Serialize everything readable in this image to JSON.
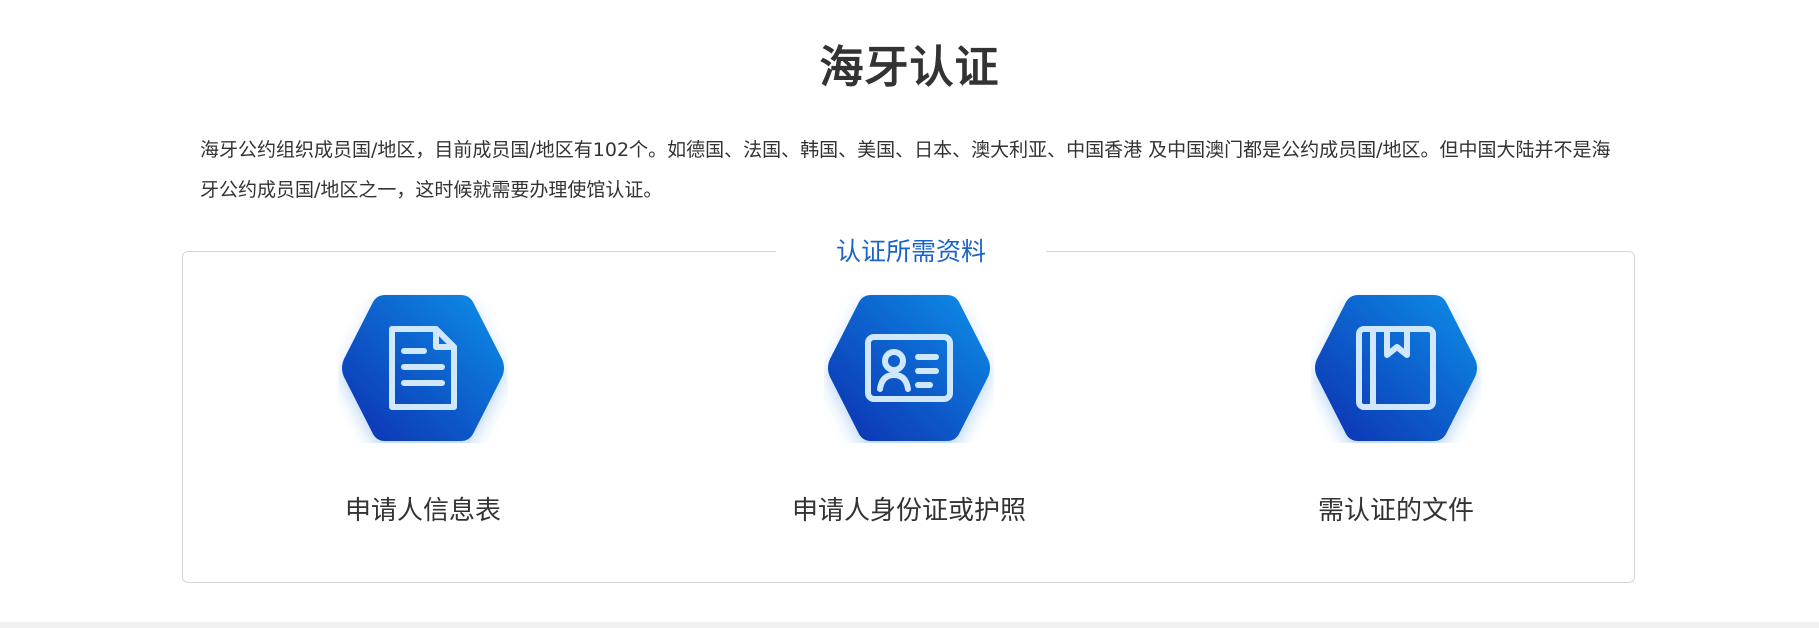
{
  "page": {
    "title": "海牙认证",
    "intro": "海牙公约组织成员国/地区，目前成员国/地区有102个。如德国、法国、韩国、美国、日本、澳大利亚、中国香港 及中国澳门都是公约成员国/地区。但中国大陆并不是海牙公约成员国/地区之一，这时候就需要办理使馆认证。"
  },
  "materials": {
    "title": "认证所需资料",
    "items": [
      {
        "label": "申请人信息表",
        "icon": "document-icon"
      },
      {
        "label": "申请人身份证或护照",
        "icon": "id-card-icon"
      },
      {
        "label": "需认证的文件",
        "icon": "bookmark-book-icon"
      }
    ]
  },
  "colors": {
    "accent": "#1a63c9",
    "hex_gradient_start": "#0a2fb0",
    "hex_gradient_end": "#0a8fe8",
    "icon_stroke": "#cfe8ff"
  }
}
